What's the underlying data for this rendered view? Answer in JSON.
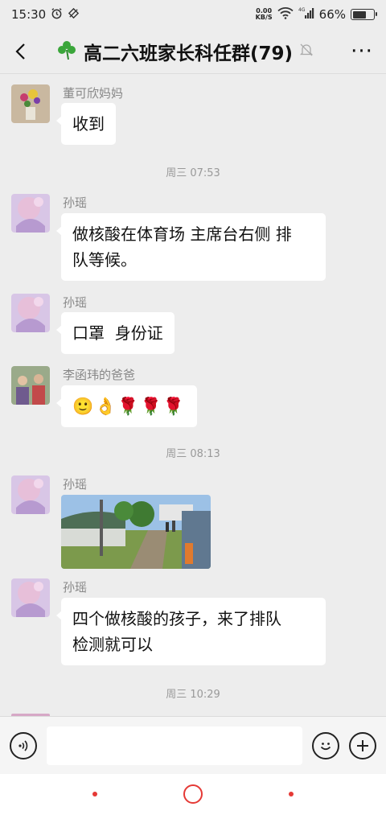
{
  "status_bar": {
    "time": "15:30",
    "net_speed_value": "0.00",
    "net_speed_unit": "KB/S",
    "battery": "66%",
    "battery_level": 0.66
  },
  "header": {
    "title": "高二六班家长科任群(79)",
    "title_icon": "shamrock-icon",
    "muted_icon": "bell-off-icon",
    "more_label": "···"
  },
  "messages": [
    {
      "type": "text",
      "sender": "董可欣妈妈",
      "text": "收到"
    },
    {
      "type": "time",
      "text": "周三 07:53"
    },
    {
      "type": "text",
      "sender": "孙瑶",
      "line1": "做核酸在体育场 主席台右侧 排",
      "line2": "队等候。"
    },
    {
      "type": "text",
      "sender": "孙瑶",
      "text": "口罩  身份证"
    },
    {
      "type": "emoji",
      "sender": "李函玮的爸爸",
      "emojis": [
        "🙂",
        "👌",
        "🌹",
        "🌹",
        "🌹"
      ]
    },
    {
      "type": "time",
      "text": "周三 08:13"
    },
    {
      "type": "image",
      "sender": "孙瑶"
    },
    {
      "type": "text",
      "sender": "孙瑶",
      "line1": "四个做核酸的孩子，来了排队",
      "line2": "检测就可以"
    },
    {
      "type": "time",
      "text": "周三 10:29"
    }
  ],
  "input_bar": {
    "voice_icon": "voice-icon",
    "emoji_icon": "emoji-face-icon",
    "plus_icon": "plus-icon",
    "input_value": ""
  },
  "colors": {
    "background": "#ededed",
    "bubble": "#ffffff",
    "nav_accent": "#e53935"
  }
}
